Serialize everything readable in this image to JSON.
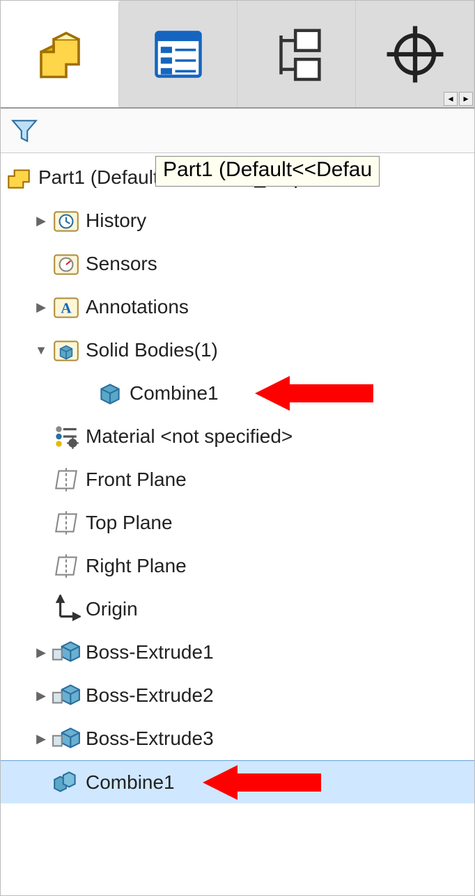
{
  "tooltip": "Part1  (Default<<Defau",
  "root": {
    "label": "Part1  (Default<<Default>_Displ"
  },
  "items": {
    "history": "History",
    "sensors": "Sensors",
    "annotations": "Annotations",
    "solidBodies": "Solid Bodies(1)",
    "combine1a": "Combine1",
    "material": "Material <not specified>",
    "frontPlane": "Front Plane",
    "topPlane": "Top Plane",
    "rightPlane": "Right Plane",
    "origin": "Origin",
    "bossExtrude1": "Boss-Extrude1",
    "bossExtrude2": "Boss-Extrude2",
    "bossExtrude3": "Boss-Extrude3",
    "combine1b": "Combine1"
  },
  "scroll": {
    "left": "◂",
    "right": "▸"
  }
}
